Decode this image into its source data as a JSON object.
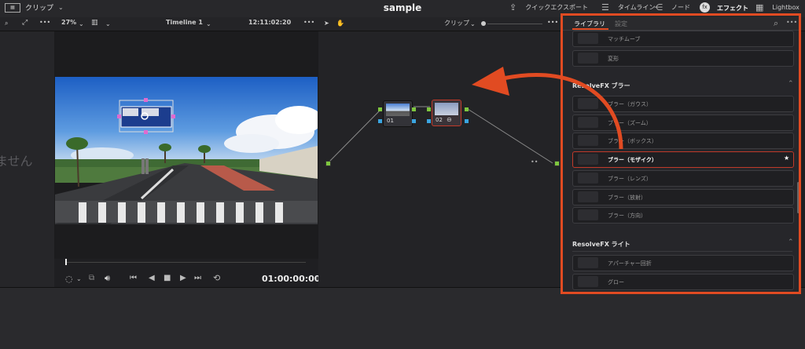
{
  "topbar": {
    "clip_menu": "クリップ",
    "title": "sample",
    "nav": [
      "クイックエクスポート",
      "タイムライン",
      "ノード",
      "エフェクト",
      "Lightbox"
    ]
  },
  "viewer_bar": {
    "zoom": "27%",
    "timeline_name": "Timeline 1",
    "timecode": "12:11:02:20",
    "clip_mode": "クリップ"
  },
  "left_pane": {
    "message": "ません"
  },
  "transport": {
    "timecode": "01:00:00:00"
  },
  "nodes": [
    {
      "label": "01"
    },
    {
      "label": "02"
    }
  ],
  "fx_panel": {
    "tabs": [
      "ライブラリ",
      "設定"
    ],
    "top_items": [
      "マッチムーブ",
      "変形"
    ],
    "sections": [
      {
        "title": "ResolveFX ブラー",
        "items": [
          "ブラー（ガウス）",
          "ブラー（ズーム）",
          "ブラー（ボックス）",
          "ブラー（モザイク）",
          "ブラー（レンズ）",
          "ブラー（放射）",
          "ブラー（方向）"
        ]
      },
      {
        "title": "ResolveFX ライト",
        "items": [
          "アパーチャー回折",
          "グロー"
        ]
      }
    ]
  },
  "colors": {
    "accent": "#e14b22",
    "selected_border": "#c13a2a",
    "node_green": "#7ec63f",
    "node_blue": "#3aa5e0"
  }
}
